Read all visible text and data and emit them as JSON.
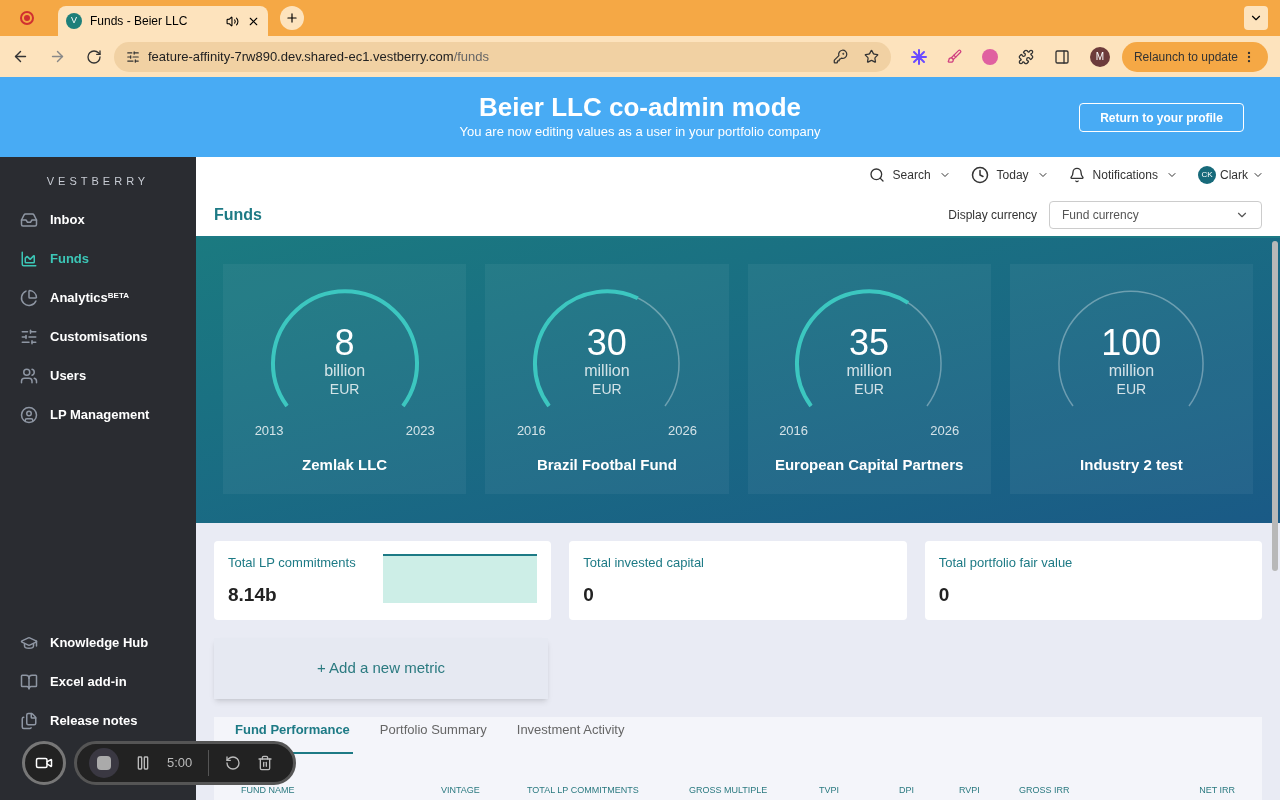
{
  "browser": {
    "tab_title": "Funds - Beier LLC",
    "tab_favicon": "V",
    "url_host": "feature-affinity-7rw890.dev.shared-ec1.vestberry.com",
    "url_path": "/funds",
    "profile_initial": "M",
    "relaunch": "Relaunch to update"
  },
  "banner": {
    "title": "Beier LLC co-admin mode",
    "subtitle": "You are now editing values as a user in your portfolio company",
    "button": "Return to your profile"
  },
  "sidebar": {
    "brand": "VESTBERRY",
    "items": [
      {
        "label": "Inbox",
        "selected": false
      },
      {
        "label": "Funds",
        "selected": true
      },
      {
        "label": "Analytics$^{BETA}$",
        "selected": false
      },
      {
        "label": "Customisations",
        "selected": false
      },
      {
        "label": "Users",
        "selected": false
      },
      {
        "label": "LP Management",
        "selected": false
      }
    ],
    "bottom_items": [
      {
        "label": "Knowledge Hub",
        "selected": false
      },
      {
        "label": "Excel add-in",
        "selected": false
      },
      {
        "label": "Release notes",
        "selected": false
      }
    ]
  },
  "topbar": {
    "search": "Search",
    "date": "Today",
    "notifications": "Notifications",
    "avatar": "CK",
    "user": "Clark"
  },
  "page": {
    "title": "Funds",
    "currency_label": "Display currency",
    "currency_value": "Fund currency"
  },
  "funds": [
    {
      "value": "8",
      "unit": "billion",
      "currency": "EUR",
      "start": "2013",
      "end": "2023",
      "name": "Zemlak LLC"
    },
    {
      "value": "30",
      "unit": "million",
      "currency": "EUR",
      "start": "2016",
      "end": "2026",
      "name": "Brazil Footbal Fund"
    },
    {
      "value": "35",
      "unit": "million",
      "currency": "EUR",
      "start": "2016",
      "end": "2026",
      "name": "European Capital Partners"
    },
    {
      "value": "100",
      "unit": "million",
      "currency": "EUR",
      "name": "Industry 2 test"
    }
  ],
  "metrics": [
    {
      "label": "Total LP commitments",
      "value": "8.14b",
      "kind": "sparkline"
    },
    {
      "label": "Total invested capital",
      "value": "0",
      "kind": "plain"
    },
    {
      "label": "Total portfolio fair value",
      "value": "0",
      "kind": "plain"
    }
  ],
  "add_metric": "+ Add a new metric",
  "tabs": [
    {
      "label": "Fund Performance",
      "selected": true
    },
    {
      "label": "Portfolio Summary",
      "selected": false
    },
    {
      "label": "Investment Activity",
      "selected": false
    }
  ],
  "table": {
    "columns": [
      "FUND NAME",
      "VINTAGE",
      "TOTAL LP COMMITMENTS",
      "GROSS MULTIPLE",
      "TVPI",
      "DPI",
      "RVPI",
      "GROSS IRR",
      "NET IRR"
    ]
  },
  "recorder": {
    "time": "5:00"
  }
}
